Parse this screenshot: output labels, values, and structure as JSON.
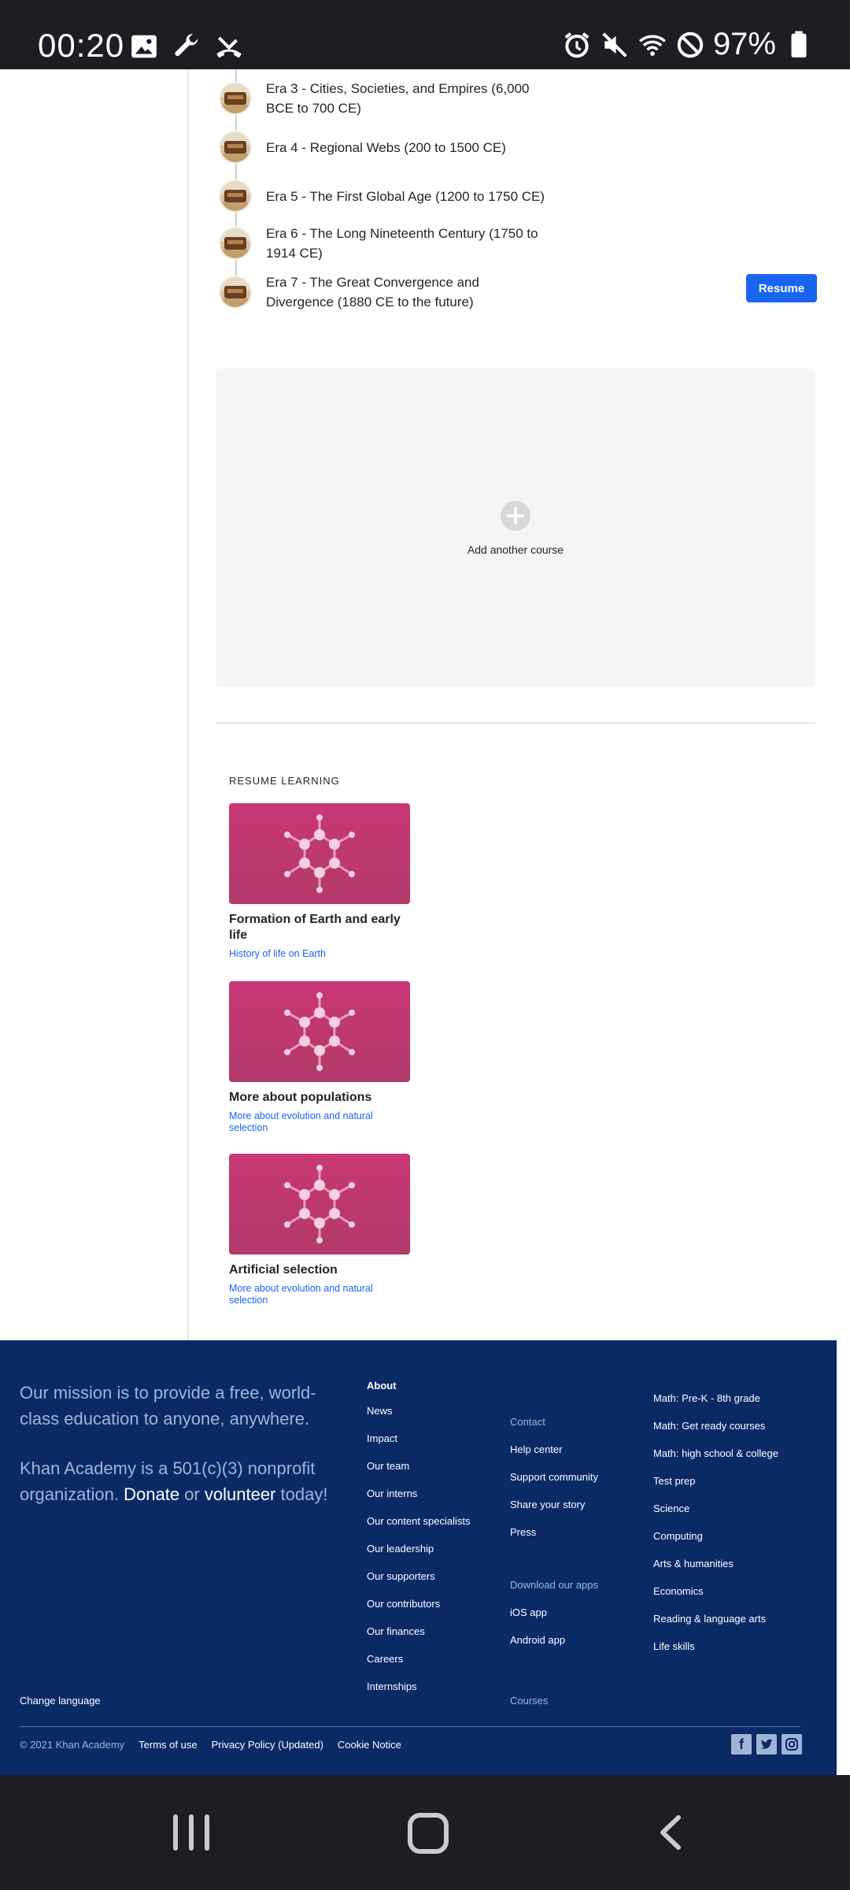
{
  "status_bar": {
    "time": "00:20",
    "battery": "97%",
    "left_icons": [
      "image-icon",
      "wrench-icon",
      "missed-call-icon"
    ],
    "right_icons": [
      "alarm-icon",
      "mute-icon",
      "wifi-icon",
      "do-not-disturb-icon",
      "battery-icon"
    ]
  },
  "course": {
    "eras": [
      {
        "label": "Era 3 - Cities, Societies, and Empires (6,000 BCE to 700 CE)"
      },
      {
        "label": "Era 4 - Regional Webs (200 to 1500 CE)"
      },
      {
        "label": "Era 5 - The First Global Age (1200 to 1750 CE)"
      },
      {
        "label": "Era 6 - The Long Nineteenth Century (1750 to 1914 CE)"
      },
      {
        "label": "Era 7 - The Great Convergence and Divergence (1880 CE to the future)"
      }
    ],
    "resume_label": "Resume"
  },
  "add_course": {
    "label": "Add another course"
  },
  "resume_learning": {
    "heading": "RESUME LEARNING",
    "cards": [
      {
        "title": "Formation of Earth and early life",
        "subtitle": "History of life on Earth"
      },
      {
        "title": "More about populations",
        "subtitle": "More about evolution and natural selection"
      },
      {
        "title": "Artificial selection",
        "subtitle": "More about evolution and natural selection"
      }
    ]
  },
  "footer": {
    "mission": "Our mission is to provide a free, world-class education to anyone, anywhere.",
    "nonprofit_pre": "Khan Academy is a 501(c)(3) nonprofit organization.",
    "donate": "Donate",
    "or": "or",
    "volunteer": "volunteer",
    "today": "today!",
    "about": {
      "heading": "About",
      "links": [
        "News",
        "Impact",
        "Our team",
        "Our interns",
        "Our content specialists",
        "Our leadership",
        "Our supporters",
        "Our contributors",
        "Our finances",
        "Careers",
        "Internships"
      ]
    },
    "contact": {
      "heading": "Contact",
      "links": [
        "Help center",
        "Support community",
        "Share your story",
        "Press"
      ]
    },
    "apps": {
      "heading": "Download our apps",
      "links": [
        "iOS app",
        "Android app"
      ]
    },
    "courses_label": "Courses",
    "subjects": [
      "Math: Pre-K - 8th grade",
      "Math: Get ready courses",
      "Math: high school & college",
      "Test prep",
      "Science",
      "Computing",
      "Arts & humanities",
      "Economics",
      "Reading & language arts",
      "Life skills"
    ],
    "change_language": "Change language",
    "copyright": "© 2021 Khan Academy",
    "legal_links": [
      "Terms of use",
      "Privacy Policy (Updated)",
      "Cookie Notice"
    ],
    "social_icons": [
      "facebook-icon",
      "twitter-icon",
      "instagram-icon"
    ]
  },
  "colors": {
    "accent": "#1865f2",
    "footer_bg": "#0a2a66",
    "card_pink": "#c93875"
  }
}
